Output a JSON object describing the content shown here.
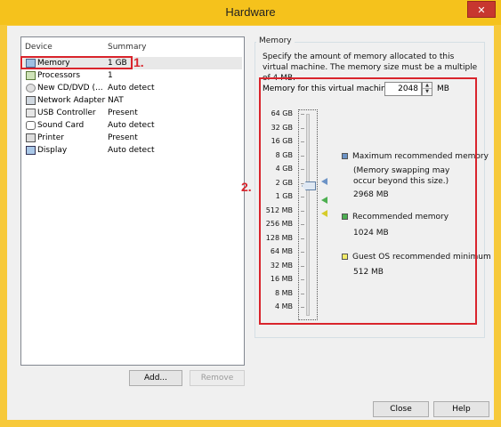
{
  "window": {
    "title": "Hardware",
    "close_glyph": "✕",
    "colors": {
      "chrome": "#f5c21c",
      "annotation": "#d9242c"
    }
  },
  "device_list": {
    "headers": {
      "device": "Device",
      "summary": "Summary"
    },
    "rows": [
      {
        "icon": "memory-icon",
        "name": "Memory",
        "summary": "1 GB",
        "selected": true
      },
      {
        "icon": "processor-icon",
        "name": "Processors",
        "summary": "1"
      },
      {
        "icon": "cd-dvd-icon",
        "name": "New CD/DVD (...",
        "summary": "Auto detect"
      },
      {
        "icon": "network-adapter-icon",
        "name": "Network Adapter",
        "summary": "NAT"
      },
      {
        "icon": "usb-controller-icon",
        "name": "USB Controller",
        "summary": "Present"
      },
      {
        "icon": "sound-card-icon",
        "name": "Sound Card",
        "summary": "Auto detect"
      },
      {
        "icon": "printer-icon",
        "name": "Printer",
        "summary": "Present"
      },
      {
        "icon": "display-icon",
        "name": "Display",
        "summary": "Auto detect"
      }
    ],
    "add_label": "Add...",
    "remove_label": "Remove"
  },
  "annotations": {
    "one": "1.",
    "two": "2."
  },
  "memory": {
    "group_label": "Memory",
    "description": "Specify the amount of memory allocated to this virtual machine. The memory size must be a multiple of 4 MB.",
    "field_label": "Memory for this virtual machine:",
    "value": "2048",
    "unit": "MB",
    "ticks": [
      "64 GB",
      "32 GB",
      "16 GB",
      "8 GB",
      "4 GB",
      "2 GB",
      "1 GB",
      "512 MB",
      "256 MB",
      "128 MB",
      "64 MB",
      "32 MB",
      "16 MB",
      "8 MB",
      "4 MB"
    ],
    "legend": {
      "max_title": "Maximum recommended memory",
      "max_note": "(Memory swapping may occur beyond this size.)",
      "max_value": "2968 MB",
      "rec_title": "Recommended memory",
      "rec_value": "1024 MB",
      "min_title": "Guest OS recommended minimum",
      "min_value": "512 MB",
      "colors": {
        "max": "#6c93c6",
        "rec": "#4caf50",
        "min": "#f3ec6a"
      }
    }
  },
  "footer": {
    "close_label": "Close",
    "help_label": "Help"
  }
}
